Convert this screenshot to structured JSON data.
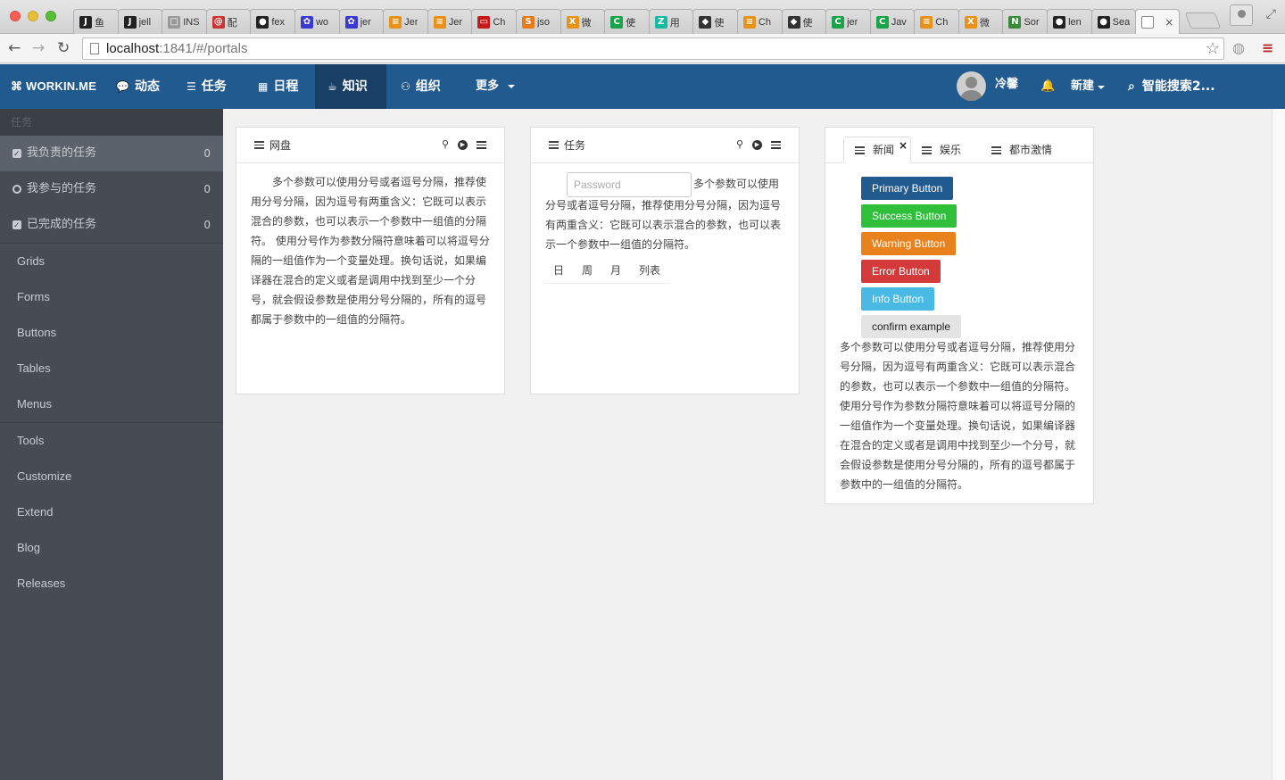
{
  "browser": {
    "tabs": [
      {
        "icon": "J",
        "color": "#222",
        "title": "鱼"
      },
      {
        "icon": "J",
        "color": "#222",
        "title": "jell"
      },
      {
        "icon": "□",
        "color": "#999",
        "title": "INS"
      },
      {
        "icon": "@",
        "color": "#c33",
        "title": "配"
      },
      {
        "icon": "●",
        "color": "#222",
        "title": "fex"
      },
      {
        "icon": "✿",
        "color": "#3a3acf",
        "title": "wo"
      },
      {
        "icon": "✿",
        "color": "#3a3acf",
        "title": "jer"
      },
      {
        "icon": "≡",
        "color": "#e8921a",
        "title": "Jer"
      },
      {
        "icon": "≡",
        "color": "#e8921a",
        "title": "Jer"
      },
      {
        "icon": "▭",
        "color": "#c41a1a",
        "title": "Ch"
      },
      {
        "icon": "S",
        "color": "#e87b1a",
        "title": "jso"
      },
      {
        "icon": "X",
        "color": "#e8921a",
        "title": "微"
      },
      {
        "icon": "C",
        "color": "#1aa34a",
        "title": "使"
      },
      {
        "icon": "Z",
        "color": "#18b9a1",
        "title": "用"
      },
      {
        "icon": "◆",
        "color": "#333",
        "title": "使"
      },
      {
        "icon": "≡",
        "color": "#e8921a",
        "title": "Ch"
      },
      {
        "icon": "◆",
        "color": "#333",
        "title": "使"
      },
      {
        "icon": "C",
        "color": "#1aa34a",
        "title": "jer"
      },
      {
        "icon": "C",
        "color": "#1aa34a",
        "title": "Jav"
      },
      {
        "icon": "≡",
        "color": "#e8921a",
        "title": "Ch"
      },
      {
        "icon": "X",
        "color": "#e8921a",
        "title": "微"
      },
      {
        "icon": "N",
        "color": "#3a8a3a",
        "title": "Sor"
      },
      {
        "icon": "●",
        "color": "#222",
        "title": "len"
      },
      {
        "icon": "●",
        "color": "#222",
        "title": "Sea"
      }
    ],
    "active_tab_close": "×",
    "url_host": "localhost",
    "url_path": ":1841/#/portals"
  },
  "navbar": {
    "brand": "WORKIN.ME",
    "items": [
      {
        "label": "动态",
        "icon": "💬"
      },
      {
        "label": "任务",
        "icon": "☰"
      },
      {
        "label": "日程",
        "icon": "▦"
      },
      {
        "label": "知识",
        "icon": "☕"
      },
      {
        "label": "组织",
        "icon": "⚇"
      }
    ],
    "more": "更多",
    "user_name": "冷馨",
    "new_label": "新建",
    "search_label": "智能搜索2..."
  },
  "sidebar": {
    "search_placeholder": "任务",
    "tasks": [
      {
        "label": "我负责的任务",
        "count": "0"
      },
      {
        "label": "我参与的任务",
        "count": "0"
      },
      {
        "label": "已完成的任务",
        "count": "0"
      }
    ],
    "group1": [
      "Grids",
      "Forms",
      "Buttons",
      "Tables",
      "Menus"
    ],
    "group2": [
      "Tools",
      "Customize",
      "Extend",
      "Blog",
      "Releases"
    ]
  },
  "panels": {
    "disk": {
      "title": "网盘",
      "text": "多个参数可以使用分号或者逗号分隔，推荐使用分号分隔，因为逗号有两重含义：它既可以表示混合的参数，也可以表示一个参数中一组值的分隔符。 使用分号作为参数分隔符意味着可以将逗号分隔的一组值作为一个变量处理。换句话说，如果编译器在混合的定义或者是调用中找到至少一个分号，就会假设参数是使用分号分隔的，所有的逗号都属于参数中的一组值的分隔符。"
    },
    "task": {
      "title": "任务",
      "password_placeholder": "Password",
      "text_first": "多个参数可以使用",
      "text_rest": "分号或者逗号分隔，推荐使用分号分隔，因为逗号有两重含义：它既可以表示混合的参数，也可以表示一个参数中一组值的分隔符。",
      "cal_tabs": [
        "日",
        "周",
        "月",
        "列表"
      ]
    },
    "news": {
      "tabs": [
        "新闻",
        "娱乐",
        "都市激情"
      ],
      "close": "×",
      "buttons": [
        {
          "label": "Primary Button",
          "color": "#215a8e"
        },
        {
          "label": "Success Button",
          "color": "#2fbf3a"
        },
        {
          "label": "Warning Button",
          "color": "#e8821d"
        },
        {
          "label": "Error Button",
          "color": "#d43a3a"
        },
        {
          "label": "Info Button",
          "color": "#4ab9e3"
        },
        {
          "label": "confirm example",
          "color": "#e4e4e4"
        }
      ],
      "text": "多个参数可以使用分号或者逗号分隔，推荐使用分号分隔，因为逗号有两重含义：它既可以表示混合的参数，也可以表示一个参数中一组值的分隔符。 使用分号作为参数分隔符意味着可以将逗号分隔的一组值作为一个变量处理。换句话说，如果编译器在混合的定义或者是调用中找到至少一个分号，就会假设参数是使用分号分隔的，所有的逗号都属于参数中的一组值的分隔符。"
    }
  }
}
